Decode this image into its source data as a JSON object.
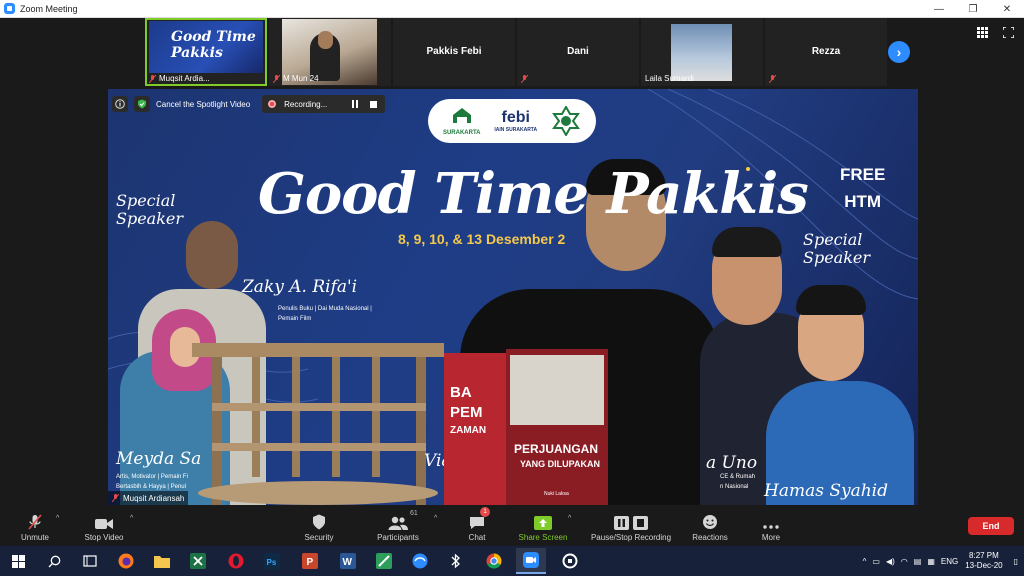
{
  "window": {
    "title": "Zoom Meeting"
  },
  "participants": [
    {
      "name": "Muqsit Ardia...",
      "muted": true,
      "kind": "slide"
    },
    {
      "name": "M Mun 24",
      "muted": true,
      "kind": "video"
    },
    {
      "name": "Pakkis Febi",
      "muted": false,
      "kind": "name"
    },
    {
      "name": "Dani",
      "muted": true,
      "kind": "name"
    },
    {
      "name": "Laila Sumardi",
      "muted": false,
      "kind": "photo"
    },
    {
      "name": "Rezza",
      "muted": true,
      "kind": "name"
    }
  ],
  "spotlight": {
    "cancel_label": "Cancel the Spotlight Video",
    "recording_label": "Recording...",
    "name_tag": "Muqsit Ardiansah"
  },
  "poster": {
    "logo_left": "SURAKARTA",
    "logo_left_top": "iain",
    "logo_mid": "febi",
    "logo_mid_sub": "IAIN SURAKARTA",
    "title": "Good Time Pakkis",
    "dates": "8, 9, 10, & 13 Desember 2",
    "free_line1": "FREE",
    "free_line2": "HTM",
    "special_left": "Special\nSpeaker",
    "special_right": "Special\nSpeaker",
    "speaker1_name": "Zaky A. Rifa'i",
    "speaker1_sub1": "Penulis Buku | Dai Muda Nasional |",
    "speaker1_sub2": "Pemain Film",
    "speaker2_name": "Meyda Sa",
    "speaker2_sub1": "Artis, Motivator | Pemain Fi",
    "speaker2_sub2": "Bertasbih & Hayya | Penul",
    "via": "Via",
    "speaker3_name": "a Uno",
    "speaker3_sub1": "CE & Rumah",
    "speaker3_sub2": "n Nasional",
    "speaker4_name": "Hamas Syahid",
    "book1": "BA PEM ZAMAN",
    "book2_title": "PERJUANGAN",
    "book2_sub": "YANG DILUPAKAN",
    "book2_author": "Nuki Laksa"
  },
  "toolbar": {
    "unmute": "Unmute",
    "stop_video": "Stop Video",
    "security": "Security",
    "participants": "Participants",
    "participants_count": "61",
    "chat": "Chat",
    "chat_badge": "1",
    "share_screen": "Share Screen",
    "pause_recording": "Pause/Stop Recording",
    "reactions": "Reactions",
    "more": "More",
    "end": "End"
  },
  "taskbar": {
    "lang": "ENG",
    "time": "8:27 PM",
    "date": "13-Dec-20"
  },
  "colors": {
    "zoom_blue": "#2d8cff",
    "end_red": "#d8292b",
    "share_green": "#7ecb2a",
    "poster_blue": "#1e3d86",
    "date_yellow": "#f6c94a"
  }
}
